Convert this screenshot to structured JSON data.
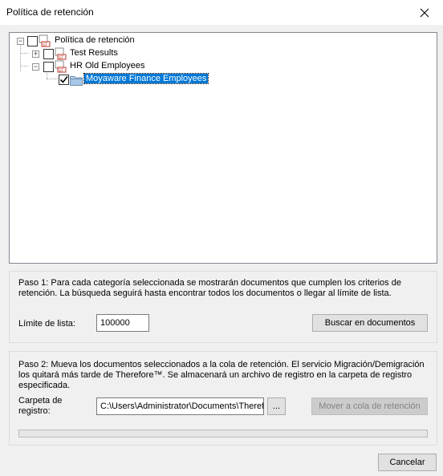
{
  "window": {
    "title": "Política de retención"
  },
  "tree": {
    "root": {
      "label": "Política de retención"
    },
    "children": [
      {
        "label": "Test Results",
        "expander": "+"
      },
      {
        "label": "HR Old Employees",
        "expander": "−"
      }
    ],
    "leaf": {
      "label": "Moyaware Finance Employees",
      "checked": true
    }
  },
  "step1": {
    "text": "Paso 1: Para cada categoría seleccionada se mostrarán documentos que cumplen los criterios de retención. La búsqueda seguirá hasta encontrar todos los documentos o llegar al límite de lista.",
    "limit_label": "Límite de lista:",
    "limit_value": "100000",
    "search_button": "Buscar en documentos"
  },
  "step2": {
    "text": "Paso 2: Mueva los documentos seleccionados a la cola de retención. El servicio Migración/Demigración los quitará más tarde de Therefore™. Se almacenará un archivo de registro en la carpeta de registro especificada.",
    "folder_label_line1": "Carpeta de",
    "folder_label_line2": "registro:",
    "folder_value": "C:\\Users\\Administrator\\Documents\\Therefore",
    "browse_button": "...",
    "move_button": "Mover a cola de retención",
    "progress": 0
  },
  "footer": {
    "cancel_button": "Cancelar"
  },
  "colors": {
    "selection": "#0078d7",
    "icon_red": "#c0392b",
    "folder_blue": "#b8d4f0"
  }
}
